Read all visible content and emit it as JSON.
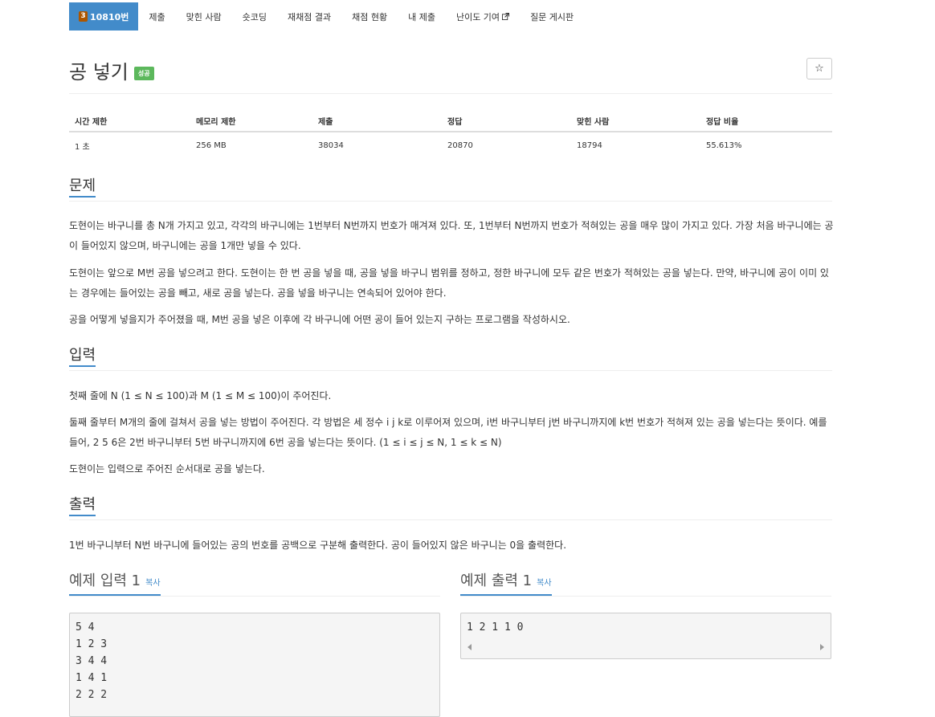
{
  "nav": {
    "level_badge": "3",
    "problem_id": "10810번",
    "items": [
      "제출",
      "맞힌 사람",
      "숏코딩",
      "재채점 결과",
      "채점 현황",
      "내 제출",
      "난이도 기여",
      "질문 게시판"
    ]
  },
  "problem": {
    "title": "공 넣기",
    "status_badge": "성공",
    "star": "☆"
  },
  "info_table": {
    "headers": [
      "시간 제한",
      "메모리 제한",
      "제출",
      "정답",
      "맞힌 사람",
      "정답 비율"
    ],
    "values": [
      "1 초",
      "256 MB",
      "38034",
      "20870",
      "18794",
      "55.613%"
    ]
  },
  "sections": {
    "description": {
      "title": "문제",
      "paragraphs": [
        "도현이는 바구니를 총 N개 가지고 있고, 각각의 바구니에는 1번부터 N번까지 번호가 매겨져 있다. 또, 1번부터 N번까지 번호가 적혀있는 공을 매우 많이 가지고 있다. 가장 처음 바구니에는 공이 들어있지 않으며, 바구니에는 공을 1개만 넣을 수 있다.",
        "도현이는 앞으로 M번 공을 넣으려고 한다. 도현이는 한 번 공을 넣을 때, 공을 넣을 바구니 범위를 정하고, 정한 바구니에 모두 같은 번호가 적혀있는 공을 넣는다. 만약, 바구니에 공이 이미 있는 경우에는 들어있는 공을 빼고, 새로 공을 넣는다. 공을 넣을 바구니는 연속되어 있어야 한다.",
        "공을 어떻게 넣을지가 주어졌을 때, M번 공을 넣은 이후에 각 바구니에 어떤 공이 들어 있는지 구하는 프로그램을 작성하시오."
      ]
    },
    "input": {
      "title": "입력",
      "paragraphs": [
        "첫째 줄에 N (1 ≤ N ≤ 100)과 M (1 ≤ M ≤ 100)이 주어진다.",
        "둘째 줄부터 M개의 줄에 걸쳐서 공을 넣는 방법이 주어진다. 각 방법은 세 정수 i j k로 이루어져 있으며, i번 바구니부터 j번 바구니까지에 k번 번호가 적혀져 있는 공을 넣는다는 뜻이다. 예를 들어, 2 5 6은 2번 바구니부터 5번 바구니까지에 6번 공을 넣는다는 뜻이다. (1 ≤ i ≤ j ≤ N, 1 ≤ k ≤ N)",
        "도현이는 입력으로 주어진 순서대로 공을 넣는다."
      ]
    },
    "output": {
      "title": "출력",
      "paragraphs": [
        "1번 바구니부터 N번 바구니에 들어있는 공의 번호를 공백으로 구분해 출력한다. 공이 들어있지 않은 바구니는 0을 출력한다."
      ]
    }
  },
  "samples": {
    "input": {
      "title": "예제 입력 1",
      "copy": "복사",
      "lines": [
        "5 4",
        "1 2 3",
        "3 4 4",
        "1 4 1",
        "2 2 2"
      ]
    },
    "output": {
      "title": "예제 출력 1",
      "copy": "복사",
      "lines": [
        "1 2 1 1 0"
      ]
    }
  },
  "colors": {
    "accent": "#428bca",
    "success": "#5cb85c",
    "level_badge": "#ad5600"
  }
}
